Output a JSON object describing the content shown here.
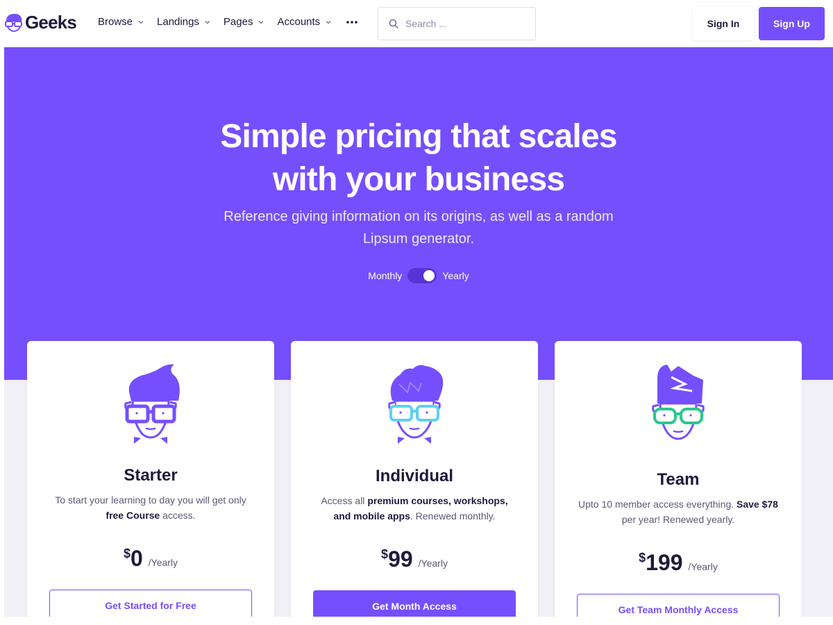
{
  "brand": {
    "name": "Geeks",
    "accent": "#754ffe"
  },
  "nav": {
    "items": [
      {
        "label": "Browse"
      },
      {
        "label": "Landings"
      },
      {
        "label": "Pages"
      },
      {
        "label": "Accounts"
      }
    ],
    "more_icon": "ellipsis-icon"
  },
  "search": {
    "placeholder": "Search ..."
  },
  "auth": {
    "signin_label": "Sign In",
    "signup_label": "Sign Up"
  },
  "hero": {
    "title_line1": "Simple pricing that scales",
    "title_line2": "with your business",
    "subtitle_line1": "Reference giving information on its origins, as well as a random",
    "subtitle_line2": "Lipsum generator.",
    "toggle": {
      "left_label": "Monthly",
      "right_label": "Yearly",
      "selected": "Yearly"
    }
  },
  "plans": [
    {
      "title": "Starter",
      "desc_parts": [
        "To start your learning to day you will get only ",
        "free Course",
        " access."
      ],
      "currency": "$",
      "amount": "0",
      "period": "/Yearly",
      "cta": "Get Started for Free",
      "glasses_color": "#754ffe"
    },
    {
      "title": "Individual",
      "desc_parts": [
        "Access all ",
        "premium courses, workshops, and mobile apps",
        ". Renewed monthly."
      ],
      "currency": "$",
      "amount": "99",
      "period": "/Yearly",
      "cta": "Get Month Access",
      "glasses_color": "#5ed0f0"
    },
    {
      "title": "Team",
      "desc_parts": [
        "Upto 10 member access everything. ",
        "Save $78",
        " per year! Renewed yearly."
      ],
      "currency": "$",
      "amount": "199",
      "period": "/Yearly",
      "cta": "Get Team Monthly Access",
      "glasses_color": "#2ac78b"
    }
  ]
}
